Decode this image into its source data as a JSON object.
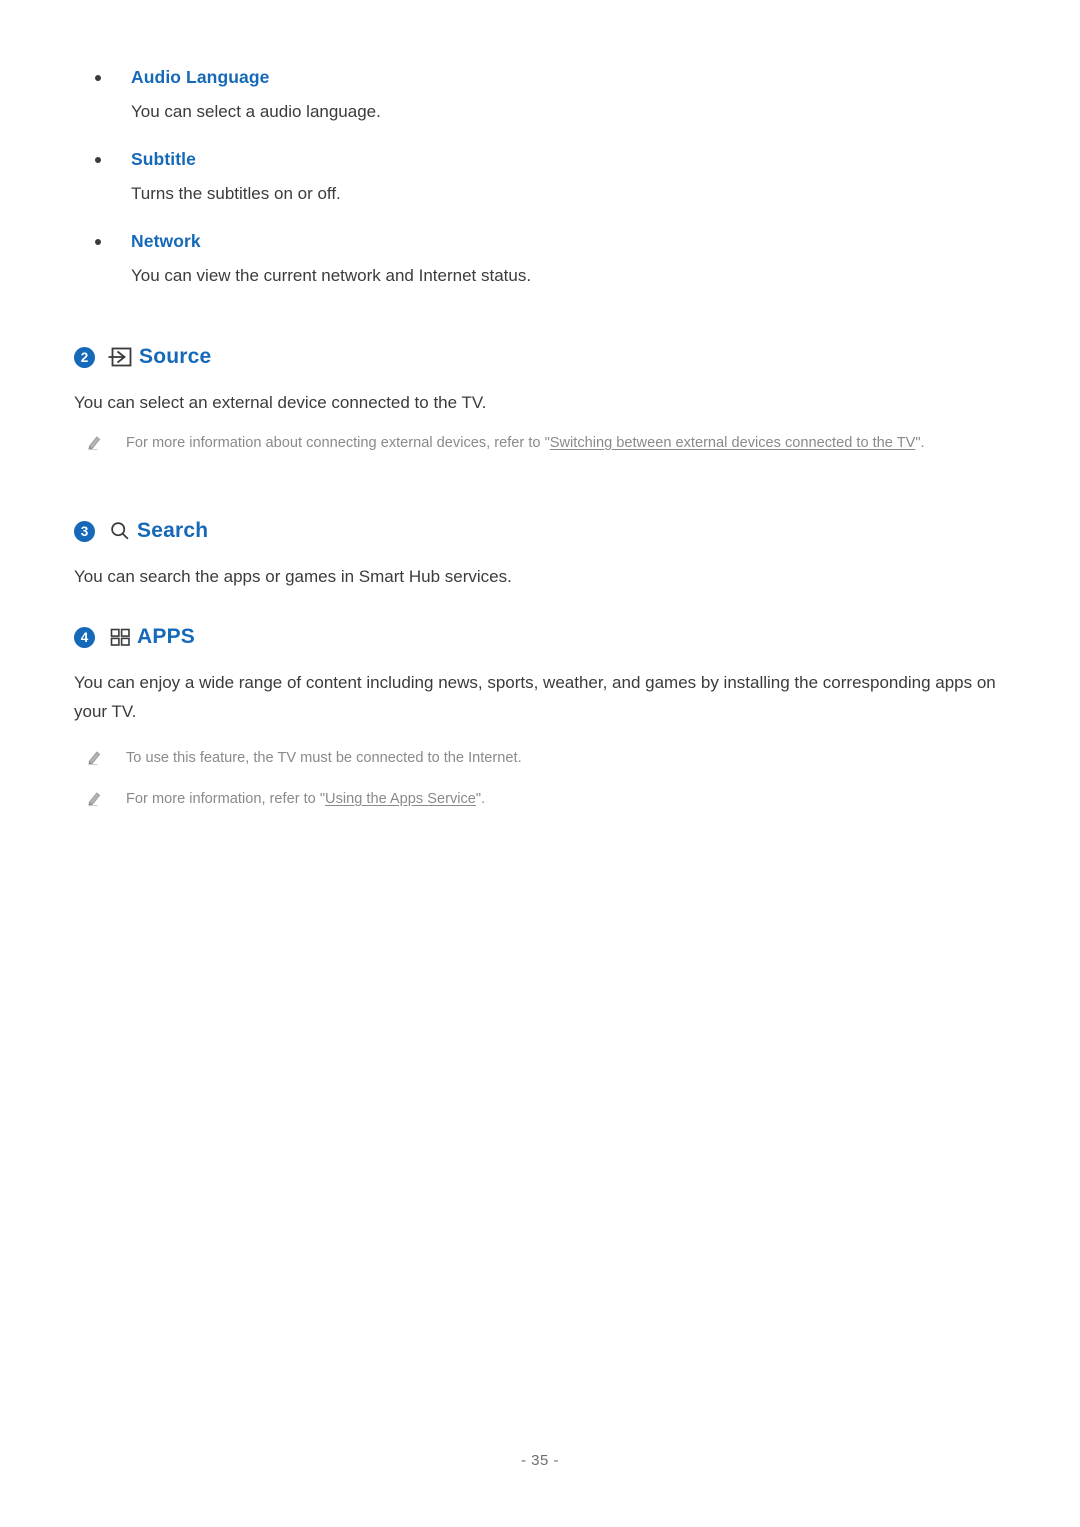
{
  "document": {
    "page_number_label": "- 35 -"
  },
  "bullets": [
    {
      "title": "Audio Language",
      "description": "You can select a audio language."
    },
    {
      "title": "Subtitle",
      "description": "Turns the subtitles on or off."
    },
    {
      "title": "Network",
      "description": "You can view the current network and Internet status."
    }
  ],
  "sections": [
    {
      "number": "2",
      "icon": "source-input-icon",
      "title": "Source",
      "body": "You can select an external device connected to the TV.",
      "notes": [
        {
          "icon": "pencil-note-icon",
          "prefix": "For more information about connecting external devices, refer to \"",
          "link": "Switching between external devices connected to the TV",
          "suffix": "\"."
        }
      ]
    },
    {
      "number": "3",
      "icon": "search-magnifier-icon",
      "title": "Search",
      "body": "You can search the apps or games in Smart Hub services.",
      "notes": []
    },
    {
      "number": "4",
      "icon": "apps-grid-icon",
      "title": "APPS",
      "body": "You can enjoy a wide range of content including news, sports, weather, and games by installing the corresponding apps on your TV.",
      "notes": [
        {
          "icon": "pencil-note-icon",
          "prefix": "To use this feature, the TV must be connected to the Internet.",
          "link": "",
          "suffix": ""
        },
        {
          "icon": "pencil-note-icon",
          "prefix": "For more information, refer to \"",
          "link": "Using the Apps Service",
          "suffix": "\"."
        }
      ]
    }
  ],
  "colors": {
    "heading_blue": "#1569b8",
    "body_text": "#3b3b3b",
    "note_gray": "#8a8a8a"
  }
}
